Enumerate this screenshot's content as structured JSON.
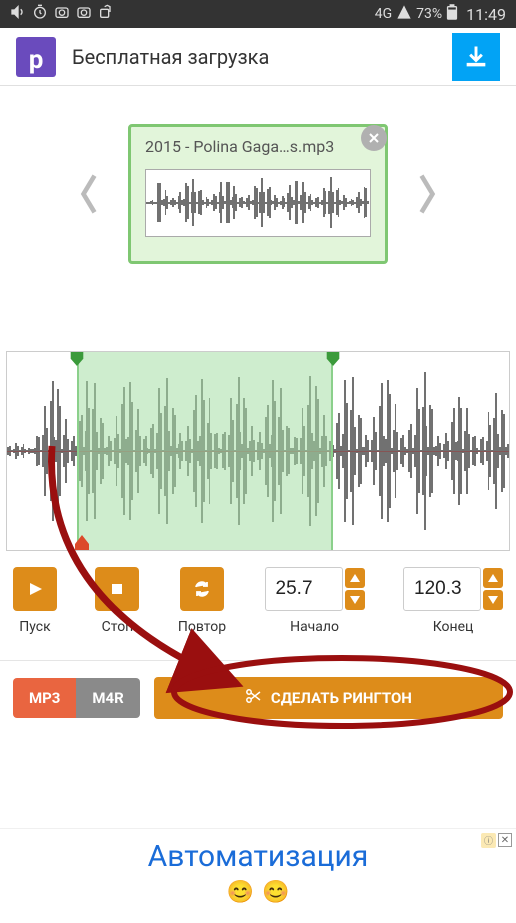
{
  "status": {
    "network": "4G",
    "battery": "73%",
    "time": "11:49"
  },
  "ad_top": {
    "logo_letter": "p",
    "text": "Бесплатная загрузка"
  },
  "file": {
    "name": "2015 - Polina Gaga…s.mp3"
  },
  "controls": {
    "play_label": "Пуск",
    "stop_label": "Стоп",
    "repeat_label": "Повтор",
    "start_label": "Начало",
    "end_label": "Конец",
    "start_value": "25.7",
    "end_value": "120.3"
  },
  "formats": {
    "mp3": "MP3",
    "m4r": "M4R"
  },
  "action": {
    "make_label": "СДЕЛАТЬ РИНГТОН"
  },
  "bottom_ad": {
    "title": "Автоматизация",
    "info_glyph": "ⓘ",
    "close_glyph": "✕"
  },
  "selection": {
    "start_pct": 14,
    "end_pct": 65,
    "playhead_pct": 15
  }
}
